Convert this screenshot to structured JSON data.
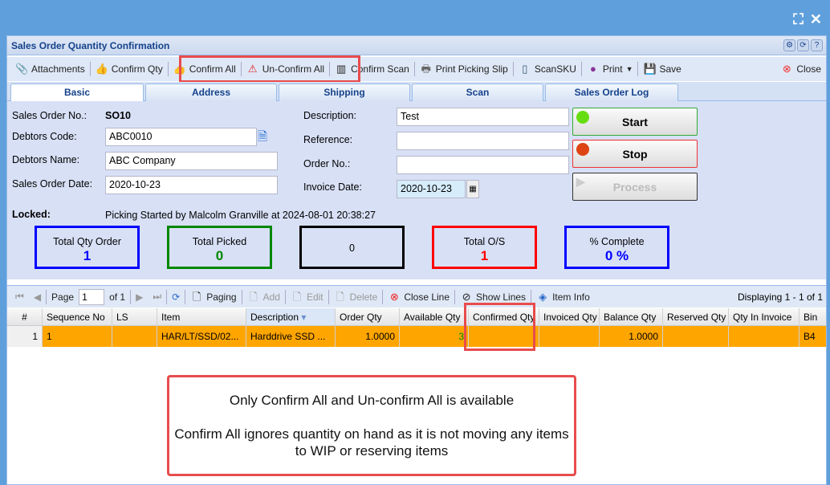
{
  "window": {
    "title": "Sales Order Quantity Confirmation",
    "title_tools": [
      "gear",
      "refresh",
      "?"
    ]
  },
  "toolbar": [
    {
      "icon": "paperclip-icon",
      "label": "Attachments"
    },
    {
      "icon": "thumbs-up-green-icon",
      "label": "Confirm Qty"
    },
    {
      "icon": "thumbs-up-blue-icon",
      "label": "Confirm All"
    },
    {
      "icon": "warning-icon",
      "label": "Un-Confirm All"
    },
    {
      "icon": "barcode-icon",
      "label": "Confirm Scan"
    },
    {
      "icon": "printer-icon",
      "label": "Print Picking Slip"
    },
    {
      "icon": "phone-icon",
      "label": "ScanSKU"
    },
    {
      "icon": "print-icon",
      "label": "Print"
    },
    {
      "icon": "save-icon",
      "label": "Save"
    },
    {
      "icon": "close-icon",
      "label": "Close"
    }
  ],
  "tabs": [
    "Basic",
    "Address",
    "Shipping",
    "Scan",
    "Sales Order Log"
  ],
  "form": {
    "so_no_label": "Sales Order No.:",
    "so_no": "SO10",
    "debtor_code_label": "Debtors Code:",
    "debtor_code": "ABC0010",
    "debtor_name_label": "Debtors Name:",
    "debtor_name": "ABC Company",
    "so_date_label": "Sales Order Date:",
    "so_date": "2020-10-23",
    "description_label": "Description:",
    "description": "Test",
    "reference_label": "Reference:",
    "reference": "",
    "order_no_label": "Order No.:",
    "order_no": "",
    "invoice_date_label": "Invoice Date:",
    "invoice_date": "2020-10-23",
    "locked_label": "Locked:",
    "locked_text": "Picking Started by Malcolm Granville at 2024-08-01 20:38:27"
  },
  "actions": {
    "start": "Start",
    "stop": "Stop",
    "process": "Process"
  },
  "stats": [
    {
      "label": "Total Qty Order",
      "value": "1",
      "color": "#0000ff"
    },
    {
      "label": "Total Picked",
      "value": "0",
      "color": "#008000"
    },
    {
      "label": "",
      "value": "0",
      "color": "#000000"
    },
    {
      "label": "Total O/S",
      "value": "1",
      "color": "#ff0000"
    },
    {
      "label": "% Complete",
      "value": "0 %",
      "color": "#0000ff"
    }
  ],
  "grid_toolbar": {
    "page_label": "Page",
    "page": "1",
    "of": "of 1",
    "paging": "Paging",
    "add": "Add",
    "edit": "Edit",
    "delete": "Delete",
    "close_line": "Close Line",
    "show_lines": "Show Lines",
    "item_info": "Item Info",
    "displaying": "Displaying 1 - 1 of 1"
  },
  "grid": {
    "columns": [
      "#",
      "Sequence No",
      "LS",
      "Item",
      "Description",
      "Order Qty",
      "Available Qty",
      "Confirmed Qty",
      "Invoiced Qty",
      "Balance Qty",
      "Reserved Qty",
      "Qty In Invoice",
      "Bin"
    ],
    "rows": [
      [
        "1",
        "1",
        "",
        "HAR/LT/SSD/02...",
        "Harddrive SSD ...",
        "1.0000",
        "3",
        "",
        "",
        "1.0000",
        "",
        "",
        "B4"
      ]
    ]
  },
  "callout": {
    "line1": "Only Confirm All and Un-confirm All is available",
    "line2": "Confirm All ignores quantity on hand as it is not moving any items to WIP or reserving items"
  }
}
